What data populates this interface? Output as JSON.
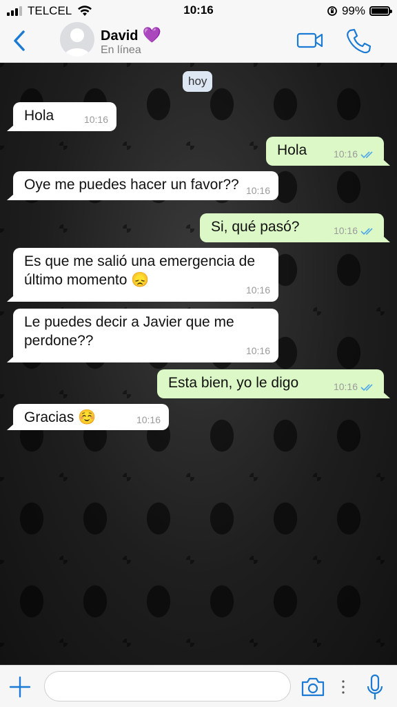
{
  "status_bar": {
    "carrier": "TELCEL",
    "time": "10:16",
    "battery": "99%",
    "battery_level": 0.99
  },
  "header": {
    "back_icon": "chevron-left-icon",
    "contact_name": "David",
    "contact_emoji": "💜",
    "contact_status": "En línea",
    "video_icon": "video-camera-icon",
    "call_icon": "phone-icon"
  },
  "chat": {
    "date_label": "hoy",
    "messages": [
      {
        "direction": "in",
        "text": "Hola",
        "time": "10:16"
      },
      {
        "direction": "out",
        "text": "Hola",
        "time": "10:16",
        "read": true
      },
      {
        "direction": "in",
        "text": "Oye me puedes hacer un favor??",
        "time": "10:16"
      },
      {
        "direction": "out",
        "text": "Si, qué pasó?",
        "time": "10:16",
        "read": true
      },
      {
        "direction": "in",
        "text": "Es que me salió una emergencia de último momento 😞",
        "time": "10:16"
      },
      {
        "direction": "in",
        "text": "Le puedes decir a Javier que me perdone??",
        "time": "10:16"
      },
      {
        "direction": "out",
        "text": "Esta bien, yo le digo",
        "time": "10:16",
        "read": true
      },
      {
        "direction": "in",
        "text": "Gracias ☺️",
        "time": "10:16"
      }
    ]
  },
  "input_bar": {
    "placeholder": "",
    "value": ""
  },
  "colors": {
    "accent": "#1a7ad4",
    "outgoing_bubble": "#dcf8c6",
    "incoming_bubble": "#ffffff",
    "read_ticks": "#4fa8e8"
  }
}
